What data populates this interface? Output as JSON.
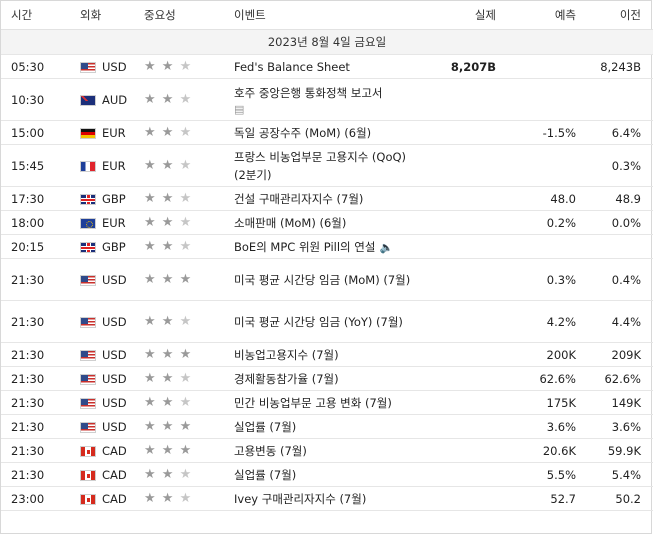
{
  "headers": {
    "time": "시간",
    "currency": "외화",
    "importance": "중요성",
    "event": "이벤트",
    "actual": "실제",
    "forecast": "예측",
    "previous": "이전"
  },
  "date_row": "2023년 8월 4일 금요일",
  "rows": [
    {
      "time": "05:30",
      "flag": "us",
      "currency": "USD",
      "stars": 2,
      "event": "Fed's Balance Sheet",
      "actual": "8,207B",
      "forecast": "",
      "previous": "8,243B",
      "icon": ""
    },
    {
      "time": "10:30",
      "flag": "au",
      "currency": "AUD",
      "stars": 2,
      "event": "호주 중앙은행 통화정책 보고서",
      "actual": "",
      "forecast": "",
      "previous": "",
      "icon": "report"
    },
    {
      "time": "15:00",
      "flag": "de",
      "currency": "EUR",
      "stars": 2,
      "event": "독일 공장수주 (MoM) (6월)",
      "actual": "",
      "forecast": "-1.5%",
      "previous": "6.4%",
      "icon": ""
    },
    {
      "time": "15:45",
      "flag": "fr",
      "currency": "EUR",
      "stars": 2,
      "event": "프랑스 비농업부문 고용지수 (QoQ) (2분기)",
      "actual": "",
      "forecast": "",
      "previous": "0.3%",
      "icon": ""
    },
    {
      "time": "17:30",
      "flag": "gb",
      "currency": "GBP",
      "stars": 2,
      "event": "건설 구매관리자지수 (7월)",
      "actual": "",
      "forecast": "48.0",
      "previous": "48.9",
      "icon": ""
    },
    {
      "time": "18:00",
      "flag": "eu",
      "currency": "EUR",
      "stars": 2,
      "event": "소매판매 (MoM) (6월)",
      "actual": "",
      "forecast": "0.2%",
      "previous": "0.0%",
      "icon": ""
    },
    {
      "time": "20:15",
      "flag": "gb",
      "currency": "GBP",
      "stars": 2,
      "event": "BoE의 MPC 위원 Pill의 연설",
      "actual": "",
      "forecast": "",
      "previous": "",
      "icon": "speaker"
    },
    {
      "time": "21:30",
      "flag": "us",
      "currency": "USD",
      "stars": 3,
      "event": "미국 평균 시간당 임금 (MoM) (7월)",
      "actual": "",
      "forecast": "0.3%",
      "previous": "0.4%",
      "icon": ""
    },
    {
      "time": "21:30",
      "flag": "us",
      "currency": "USD",
      "stars": 2,
      "event": "미국 평균 시간당 임금 (YoY) (7월)",
      "actual": "",
      "forecast": "4.2%",
      "previous": "4.4%",
      "icon": ""
    },
    {
      "time": "21:30",
      "flag": "us",
      "currency": "USD",
      "stars": 3,
      "event": "비농업고용지수 (7월)",
      "actual": "",
      "forecast": "200K",
      "previous": "209K",
      "icon": ""
    },
    {
      "time": "21:30",
      "flag": "us",
      "currency": "USD",
      "stars": 2,
      "event": "경제활동참가율 (7월)",
      "actual": "",
      "forecast": "62.6%",
      "previous": "62.6%",
      "icon": ""
    },
    {
      "time": "21:30",
      "flag": "us",
      "currency": "USD",
      "stars": 2,
      "event": "민간 비농업부문 고용 변화 (7월)",
      "actual": "",
      "forecast": "175K",
      "previous": "149K",
      "icon": ""
    },
    {
      "time": "21:30",
      "flag": "us",
      "currency": "USD",
      "stars": 3,
      "event": "실업률 (7월)",
      "actual": "",
      "forecast": "3.6%",
      "previous": "3.6%",
      "icon": ""
    },
    {
      "time": "21:30",
      "flag": "ca",
      "currency": "CAD",
      "stars": 3,
      "event": "고용변동 (7월)",
      "actual": "",
      "forecast": "20.6K",
      "previous": "59.9K",
      "icon": ""
    },
    {
      "time": "21:30",
      "flag": "ca",
      "currency": "CAD",
      "stars": 2,
      "event": "실업률 (7월)",
      "actual": "",
      "forecast": "5.5%",
      "previous": "5.4%",
      "icon": ""
    },
    {
      "time": "23:00",
      "flag": "ca",
      "currency": "CAD",
      "stars": 2,
      "event": "Ivey 구매관리자지수 (7월)",
      "actual": "",
      "forecast": "52.7",
      "previous": "50.2",
      "icon": ""
    }
  ],
  "icons": {
    "report": "document-icon",
    "speaker": "speaker-icon",
    "star": "star-icon"
  }
}
